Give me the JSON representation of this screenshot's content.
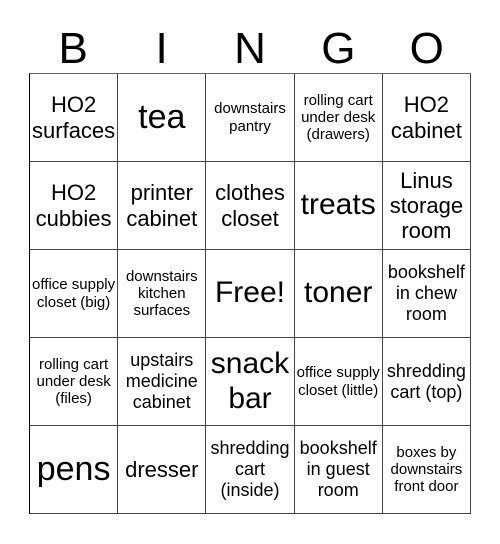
{
  "title_letters": [
    "B",
    "I",
    "N",
    "G",
    "O"
  ],
  "cells": [
    [
      "HO2 surfaces",
      "tea",
      "downstairs pantry",
      "rolling cart under desk (drawers)",
      "HO2 cabinet"
    ],
    [
      "HO2 cubbies",
      "printer cabinet",
      "clothes closet",
      "treats",
      "Linus storage room"
    ],
    [
      "office supply closet (big)",
      "downstairs kitchen surfaces",
      "Free!",
      "toner",
      "bookshelf in chew room"
    ],
    [
      "rolling cart under desk (files)",
      "upstairs medicine cabinet",
      "snack bar",
      "office supply closet (little)",
      "shredding cart (top)"
    ],
    [
      "pens",
      "dresser",
      "shredding cart (inside)",
      "bookshelf in guest room",
      "boxes by downstairs front door"
    ]
  ]
}
